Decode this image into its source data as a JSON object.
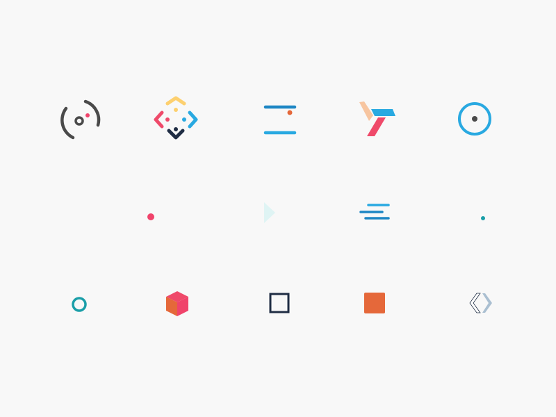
{
  "colors": {
    "background": "#f8f8f8",
    "dark_gray": "#4a4a4a",
    "red": "#f0436b",
    "pink": "#ef4a6a",
    "yellow": "#fdd06f",
    "blue": "#29a9e1",
    "navy": "#1f2d44",
    "orange": "#e5683a",
    "peach": "#f7c5a0",
    "teal": "#1a9ea8",
    "mint": "#dff4f4",
    "slate": "#aabfd1",
    "dark_blue": "#1d86c4"
  },
  "icons": [
    {
      "name": "ring-orbit-icon"
    },
    {
      "name": "diamond-arrows-icon"
    },
    {
      "name": "stacked-bars-dot-icon"
    },
    {
      "name": "folded-y-icon"
    },
    {
      "name": "circle-dot-icon"
    },
    {
      "name": "blank-icon"
    },
    {
      "name": "small-dot-icon"
    },
    {
      "name": "play-triangle-icon"
    },
    {
      "name": "speed-lines-icon"
    },
    {
      "name": "tiny-dot-icon"
    },
    {
      "name": "ring-icon"
    },
    {
      "name": "cube-icon"
    },
    {
      "name": "square-outline-icon"
    },
    {
      "name": "square-filled-icon"
    },
    {
      "name": "code-brackets-icon"
    }
  ]
}
